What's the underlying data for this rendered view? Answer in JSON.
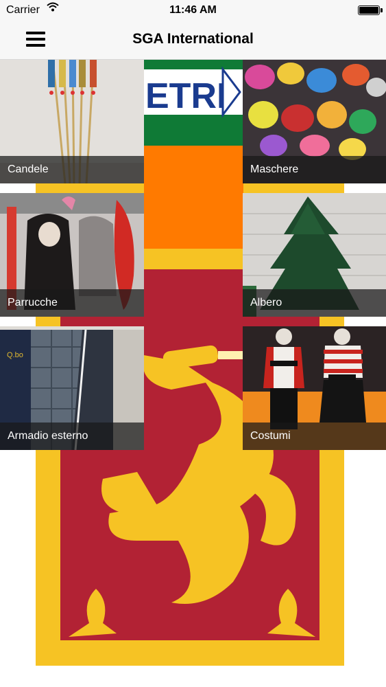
{
  "status_bar": {
    "carrier": "Carrier",
    "time": "11:46 AM"
  },
  "nav": {
    "title": "SGA International",
    "menu_icon": "hamburger-menu-icon"
  },
  "background": {
    "sign_text": "ETRI",
    "flag_colors": {
      "maroon": "#b22234",
      "gold": "#f6c324",
      "orange": "#ff7a00",
      "green": "#0f7a36"
    }
  },
  "tiles": [
    {
      "label": "Candele"
    },
    {
      "label": "Maschere"
    },
    {
      "label": "Parrucche"
    },
    {
      "label": "Albero"
    },
    {
      "label": "Armadio esterno"
    },
    {
      "label": "Costumi"
    }
  ]
}
